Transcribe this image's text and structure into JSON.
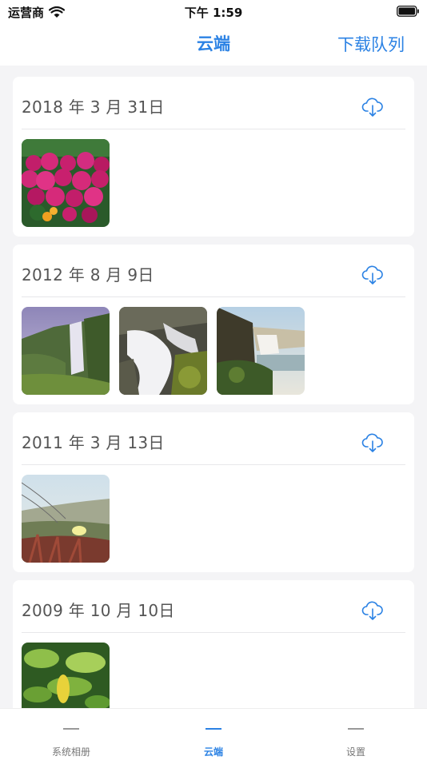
{
  "status": {
    "carrier": "运营商",
    "time": "下午 1:59"
  },
  "nav": {
    "title": "云端",
    "right_button": "下载队列"
  },
  "groups": [
    {
      "date": "2018 年 3 月 31日",
      "photos": [
        "pink-flowers"
      ]
    },
    {
      "date": "2012 年 8 月 9日",
      "photos": [
        "waterfall-valley",
        "waterfall-closeup",
        "waterfall-cliff"
      ]
    },
    {
      "date": "2011 年 3 月 13日",
      "photos": [
        "beach-flower"
      ]
    },
    {
      "date": "2009 年 10 月 10日",
      "photos": [
        "green-leaves"
      ]
    }
  ],
  "tabs": [
    {
      "label": "系统相册",
      "active": false
    },
    {
      "label": "云端",
      "active": true
    },
    {
      "label": "设置",
      "active": false
    }
  ],
  "icons": {
    "download": "cloud-download-icon",
    "wifi": "wifi-icon",
    "battery": "battery-icon"
  },
  "colors": {
    "accent": "#2b82e4",
    "background": "#f4f4f6"
  }
}
